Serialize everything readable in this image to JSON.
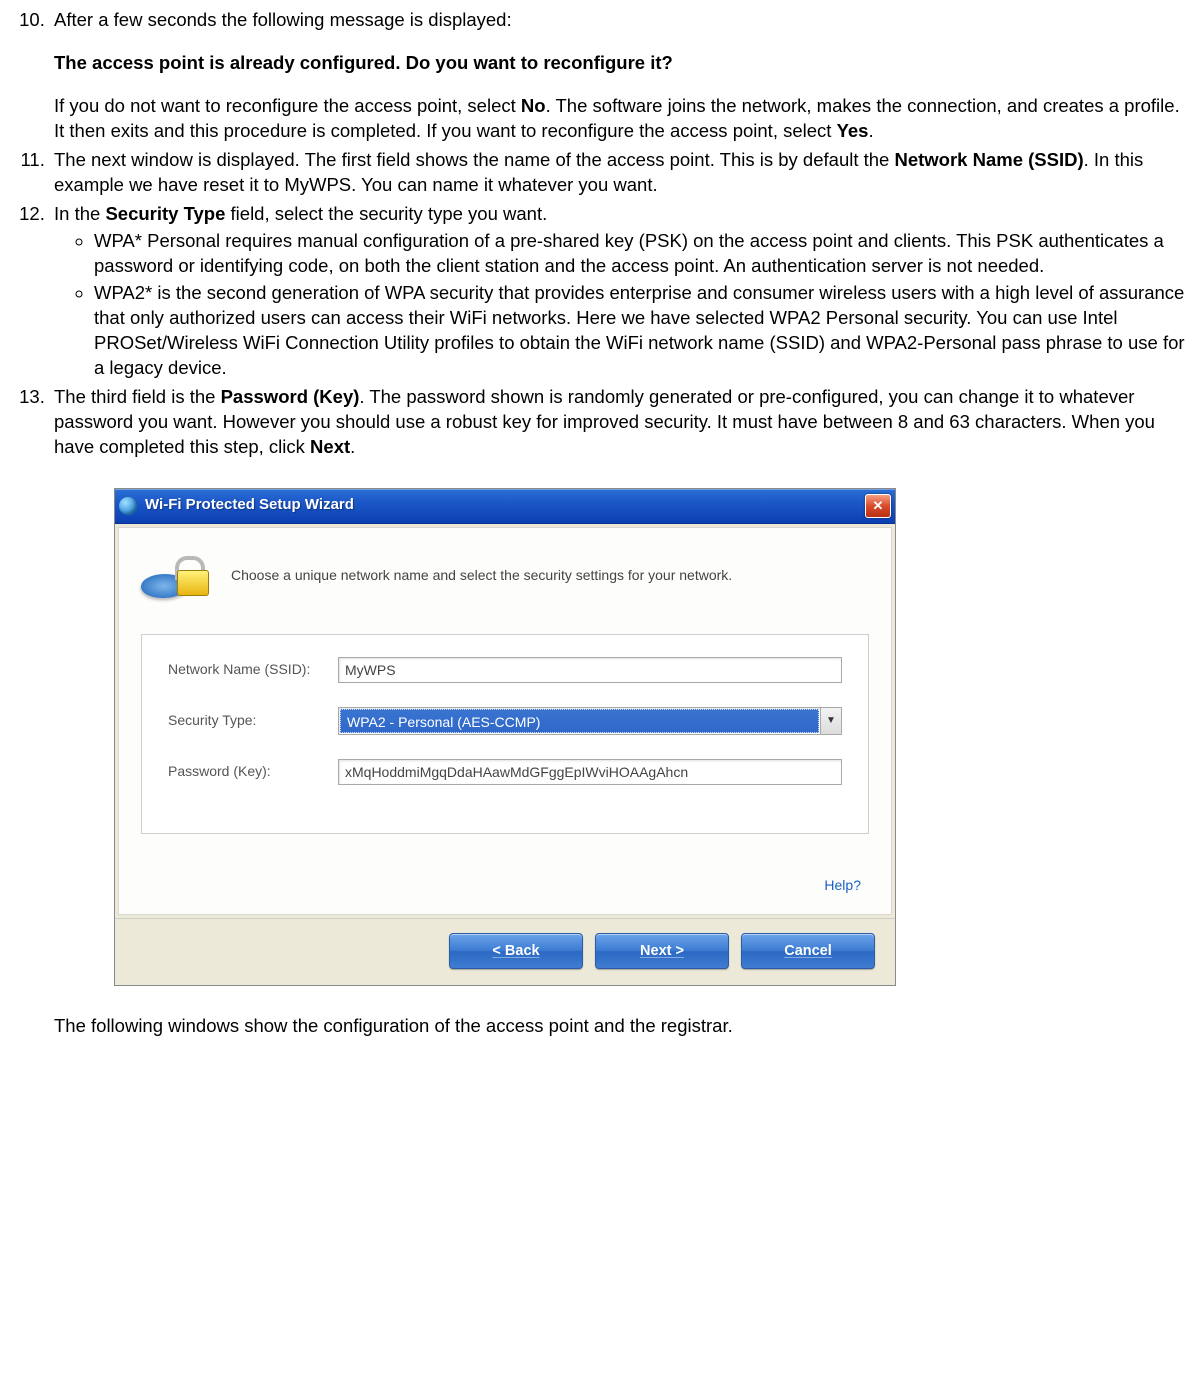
{
  "items": {
    "i10_a": "After a few seconds the following message is displayed:",
    "i10_bold": "The access point is already configured. Do you want to reconfigure it?",
    "i10_b1": "If you do not want to reconfigure the access point, select ",
    "i10_b_no": "No",
    "i10_b2": ". The software joins the network, makes the connection, and creates a profile. It then exits and this procedure is completed. If you want to reconfigure the access point, select ",
    "i10_b_yes": "Yes",
    "i10_b3": ".",
    "i11_a": "The next window is displayed. The first field shows the name of the access point. This is by default the ",
    "i11_b": "Network Name (SSID)",
    "i11_c": ". In this example we have reset it to MyWPS. You can name it whatever you want.",
    "i12_a": "In the ",
    "i12_b": "Security Type",
    "i12_c": " field, select the security type you want.",
    "i12_sub1": "WPA* Personal requires manual configuration of a pre-shared key (PSK) on the access point and clients. This PSK authenticates a password or identifying code, on both the client station and the access point. An authentication server is not needed.",
    "i12_sub2": "WPA2* is the second generation of WPA security that provides enterprise and consumer wireless users with a high level of assurance that only authorized users can access their WiFi networks. Here we have selected WPA2 Personal security. You can use Intel PROSet/Wireless WiFi Connection Utility profiles to obtain the WiFi network name (SSID) and WPA2-Personal pass phrase to use for a legacy device.",
    "i13_a": "The third field is the ",
    "i13_b": "Password (Key)",
    "i13_c": ". The password shown is randomly generated or pre-configured, you can change it to whatever password you want. However you should use a robust key for improved security. It must have between 8 and 63 characters. When you have completed this step, click ",
    "i13_d": "Next",
    "i13_e": "."
  },
  "wizard": {
    "title": "Wi-Fi Protected Setup Wizard",
    "instruction": "Choose a unique network name and select the security settings for your network.",
    "labels": {
      "ssid": "Network Name (SSID):",
      "sectype": "Security Type:",
      "password": "Password (Key):"
    },
    "values": {
      "ssid": "MyWPS",
      "sectype": "WPA2 - Personal (AES-CCMP)",
      "password": "xMqHoddmiMgqDdaHAawMdGFggEpIWviHOAAgAhcn"
    },
    "help": "Help?",
    "buttons": {
      "back": "<  Back",
      "next": "Next  >",
      "cancel": "Cancel"
    }
  },
  "follow": "The following windows show the configuration of the access point and the registrar."
}
